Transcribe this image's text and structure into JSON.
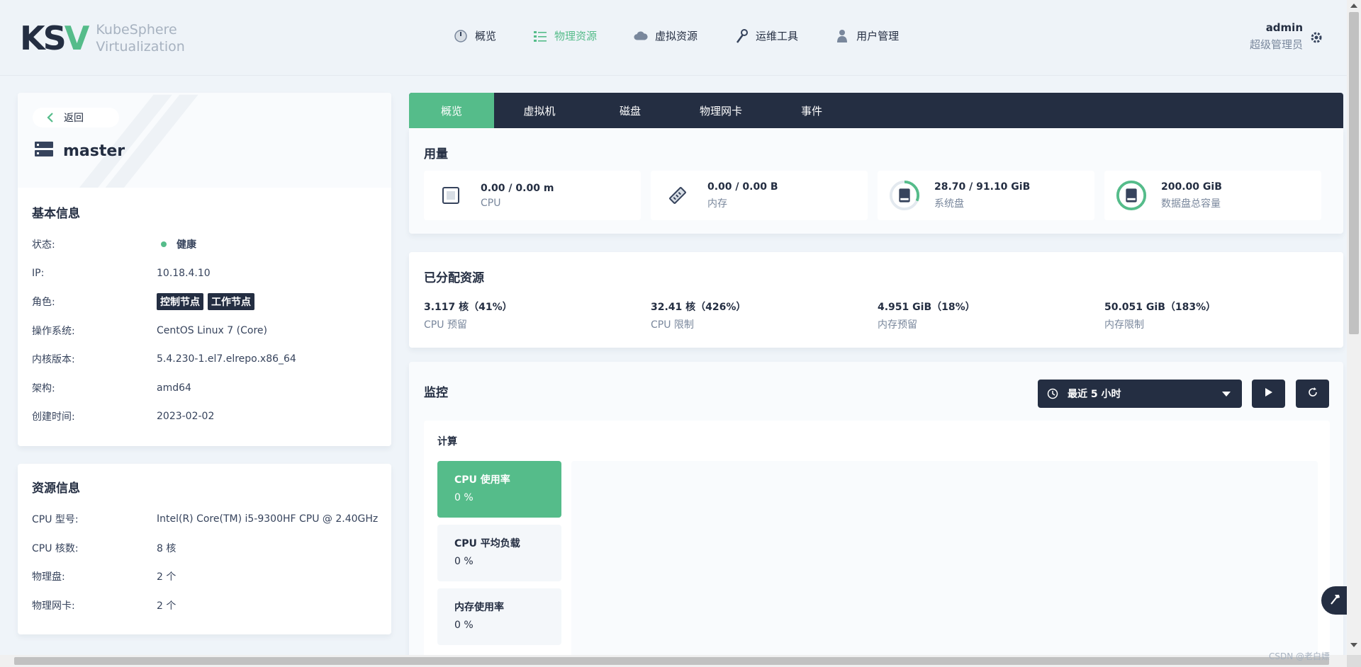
{
  "brand": {
    "logo_text": "KSV",
    "line1": "KubeSphere",
    "line2": "Virtualization"
  },
  "nav": {
    "items": [
      {
        "label": "概览",
        "icon": "dashboard-icon"
      },
      {
        "label": "物理资源",
        "icon": "list-icon",
        "active": true
      },
      {
        "label": "虚拟资源",
        "icon": "cloud-icon"
      },
      {
        "label": "运维工具",
        "icon": "wrench-icon"
      },
      {
        "label": "用户管理",
        "icon": "user-icon"
      }
    ]
  },
  "user": {
    "name": "admin",
    "role": "超级管理员"
  },
  "host": {
    "back_label": "返回",
    "name": "master"
  },
  "basic_info": {
    "title": "基本信息",
    "status_label": "状态:",
    "status_value": "健康",
    "ip_label": "IP:",
    "ip_value": "10.18.4.10",
    "role_label": "角色:",
    "role_tags": [
      "控制节点",
      "工作节点"
    ],
    "os_label": "操作系统:",
    "os_value": "CentOS Linux 7 (Core)",
    "kernel_label": "内核版本:",
    "kernel_value": "5.4.230-1.el7.elrepo.x86_64",
    "arch_label": "架构:",
    "arch_value": "amd64",
    "created_label": "创建时间:",
    "created_value": "2023-02-02"
  },
  "resource_info": {
    "title": "资源信息",
    "cpu_model_label": "CPU 型号:",
    "cpu_model_value": "Intel(R) Core(TM) i5-9300HF CPU @ 2.40GHz",
    "cpu_cores_label": "CPU 核数:",
    "cpu_cores_value": "8 核",
    "disks_label": "物理盘:",
    "disks_value": "2 个",
    "nics_label": "物理网卡:",
    "nics_value": "2 个"
  },
  "tabs": [
    "概览",
    "虚拟机",
    "磁盘",
    "物理网卡",
    "事件"
  ],
  "usage": {
    "title": "用量",
    "items": [
      {
        "value": "0.00 / 0.00 m",
        "label": "CPU",
        "icon": "cpu-icon"
      },
      {
        "value": "0.00 / 0.00 B",
        "label": "内存",
        "icon": "memory-icon"
      },
      {
        "value": "28.70 / 91.10 GiB",
        "label": "系统盘",
        "icon": "disk-gauge-icon",
        "fraction": 0.315
      },
      {
        "value": "200.00 GiB",
        "label": "数据盘总容量",
        "icon": "disk-gauge-icon",
        "fraction": 1.0
      }
    ]
  },
  "allocated": {
    "title": "已分配资源",
    "items": [
      {
        "value": "3.117 核（41%）",
        "label": "CPU 预留"
      },
      {
        "value": "32.41 核（426%）",
        "label": "CPU 限制"
      },
      {
        "value": "4.951 GiB（18%）",
        "label": "内存预留"
      },
      {
        "value": "50.051 GiB（183%）",
        "label": "内存限制"
      }
    ]
  },
  "monitoring": {
    "title": "监控",
    "time_range": "最近 5 小时",
    "section": "计算",
    "metrics": [
      {
        "title": "CPU 使用率",
        "value": "0 %",
        "active": true
      },
      {
        "title": "CPU 平均负载",
        "value": "0 %"
      },
      {
        "title": "内存使用率",
        "value": "0 %"
      }
    ]
  },
  "colors": {
    "accent": "#55bc8a",
    "dark": "#242e42",
    "muted": "#79879c"
  },
  "footer_watermark": "CSDN @老白嫖"
}
